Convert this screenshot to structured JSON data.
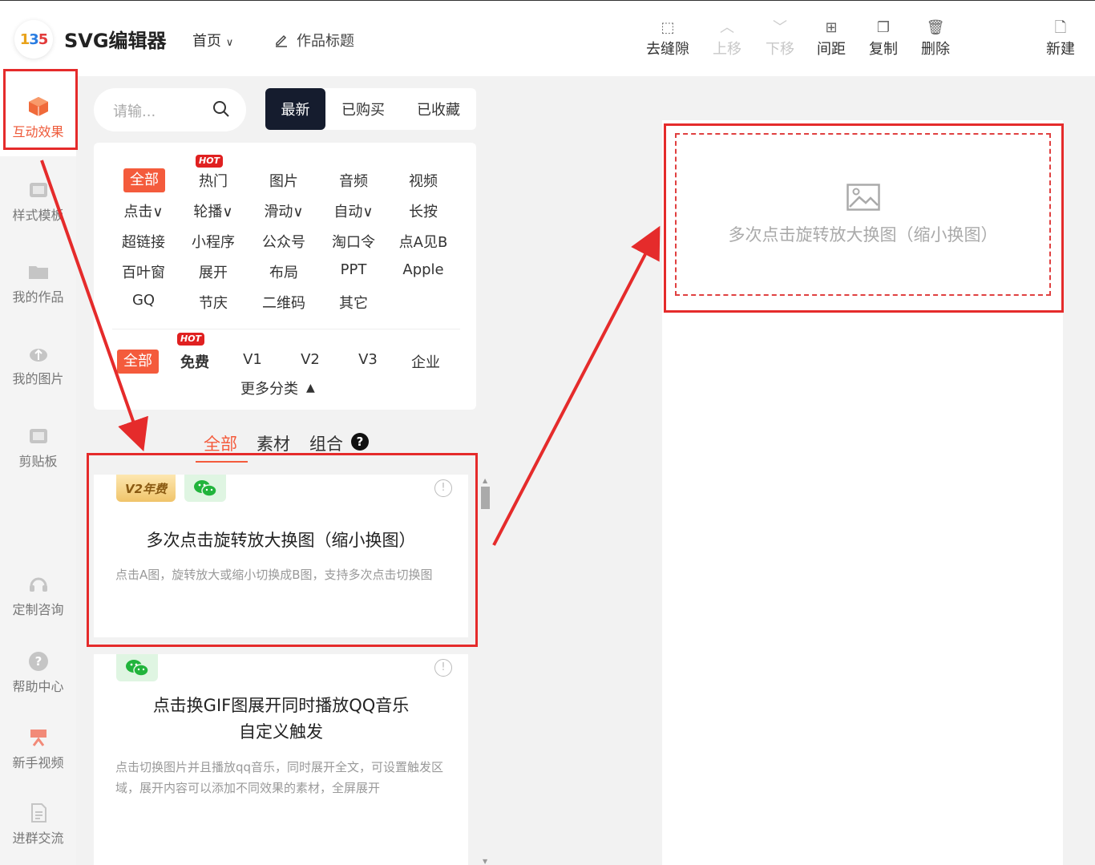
{
  "header": {
    "logo_text": "135",
    "brand": "SVG编辑器",
    "home": "首页",
    "work_title": "作品标题",
    "toolbar": {
      "remove_gap": "去缝隙",
      "move_up": "上移",
      "move_down": "下移",
      "spacing": "间距",
      "copy": "复制",
      "delete": "删除",
      "new": "新建"
    }
  },
  "sidebar": {
    "items": [
      {
        "label": "互动效果",
        "active": true
      },
      {
        "label": "样式模板"
      },
      {
        "label": "我的作品"
      },
      {
        "label": "我的图片"
      },
      {
        "label": "剪贴板"
      },
      {
        "label": "定制咨询"
      },
      {
        "label": "帮助中心"
      },
      {
        "label": "新手视频"
      },
      {
        "label": "进群交流"
      }
    ]
  },
  "search": {
    "placeholder": "请输..."
  },
  "sort_tabs": [
    "最新",
    "已购买",
    "已收藏"
  ],
  "categories": {
    "row1": [
      "全部",
      "热门",
      "图片",
      "音频",
      "视频"
    ],
    "row2": [
      "点击∨",
      "轮播∨",
      "滑动∨",
      "自动∨",
      "长按"
    ],
    "row3": [
      "超链接",
      "小程序",
      "公众号",
      "淘口令",
      "点A见B"
    ],
    "row4": [
      "百叶窗",
      "展开",
      "布局",
      "PPT",
      "Apple"
    ],
    "row5": [
      "GQ",
      "节庆",
      "二维码",
      "其它"
    ],
    "hot_label": "HOT"
  },
  "versions": {
    "items": [
      "全部",
      "免费",
      "V1",
      "V2",
      "V3",
      "企业"
    ],
    "more": "更多分类"
  },
  "type_tabs": [
    "全部",
    "素材",
    "组合"
  ],
  "cards": [
    {
      "badge": "V2年费",
      "title": "多次点击旋转放大换图（缩小换图）",
      "desc": "点击A图，旋转放大或缩小切换成B图，支持多次点击切换图"
    },
    {
      "title_line1": "点击换GIF图展开同时播放QQ音乐",
      "title_line2": "自定义触发",
      "desc": "点击切换图片并且播放qq音乐，同时展开全文，可设置触发区域，展开内容可以添加不同效果的素材，全屏展开"
    }
  ],
  "canvas": {
    "placeholder_text": "多次点击旋转放大换图（缩小换图）"
  },
  "colors": {
    "accent": "#f45b3c",
    "dark": "#151c2e",
    "annotation": "#e52b2b"
  }
}
